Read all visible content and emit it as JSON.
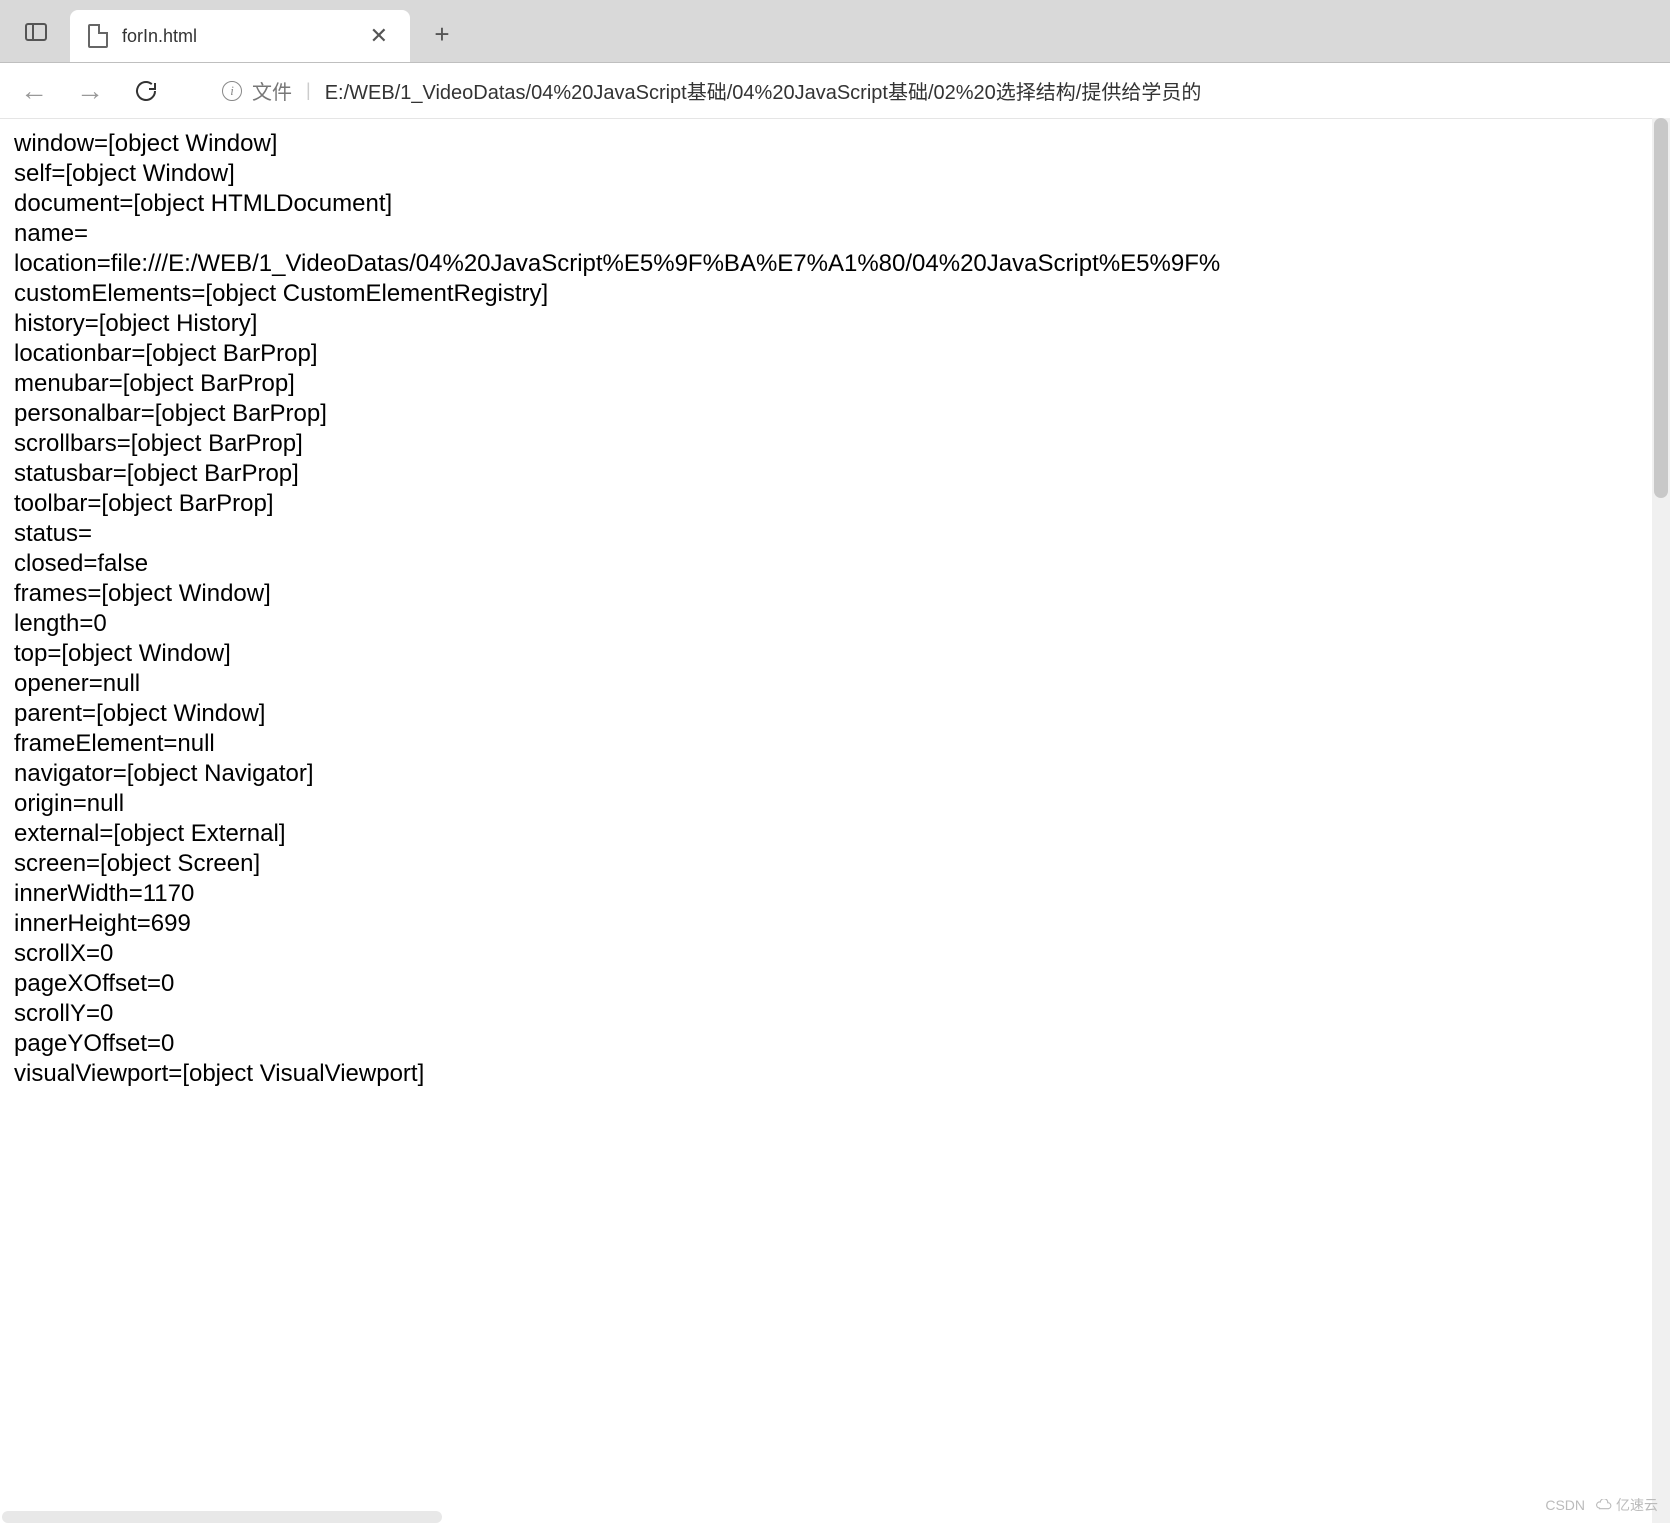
{
  "browser": {
    "tab": {
      "title": "forIn.html"
    },
    "address": {
      "source_label": "文件",
      "url": "E:/WEB/1_VideoDatas/04%20JavaScript基础/04%20JavaScript基础/02%20选择结构/提供给学员的"
    }
  },
  "content_lines": [
    "window=[object Window]",
    "self=[object Window]",
    "document=[object HTMLDocument]",
    "name=",
    "location=file:///E:/WEB/1_VideoDatas/04%20JavaScript%E5%9F%BA%E7%A1%80/04%20JavaScript%E5%9F%",
    "customElements=[object CustomElementRegistry]",
    "history=[object History]",
    "locationbar=[object BarProp]",
    "menubar=[object BarProp]",
    "personalbar=[object BarProp]",
    "scrollbars=[object BarProp]",
    "statusbar=[object BarProp]",
    "toolbar=[object BarProp]",
    "status=",
    "closed=false",
    "frames=[object Window]",
    "length=0",
    "top=[object Window]",
    "opener=null",
    "parent=[object Window]",
    "frameElement=null",
    "navigator=[object Navigator]",
    "origin=null",
    "external=[object External]",
    "screen=[object Screen]",
    "innerWidth=1170",
    "innerHeight=699",
    "scrollX=0",
    "pageXOffset=0",
    "scrollY=0",
    "pageYOffset=0",
    "visualViewport=[object VisualViewport]"
  ],
  "watermark": {
    "left": "CSDN",
    "right": "亿速云"
  }
}
